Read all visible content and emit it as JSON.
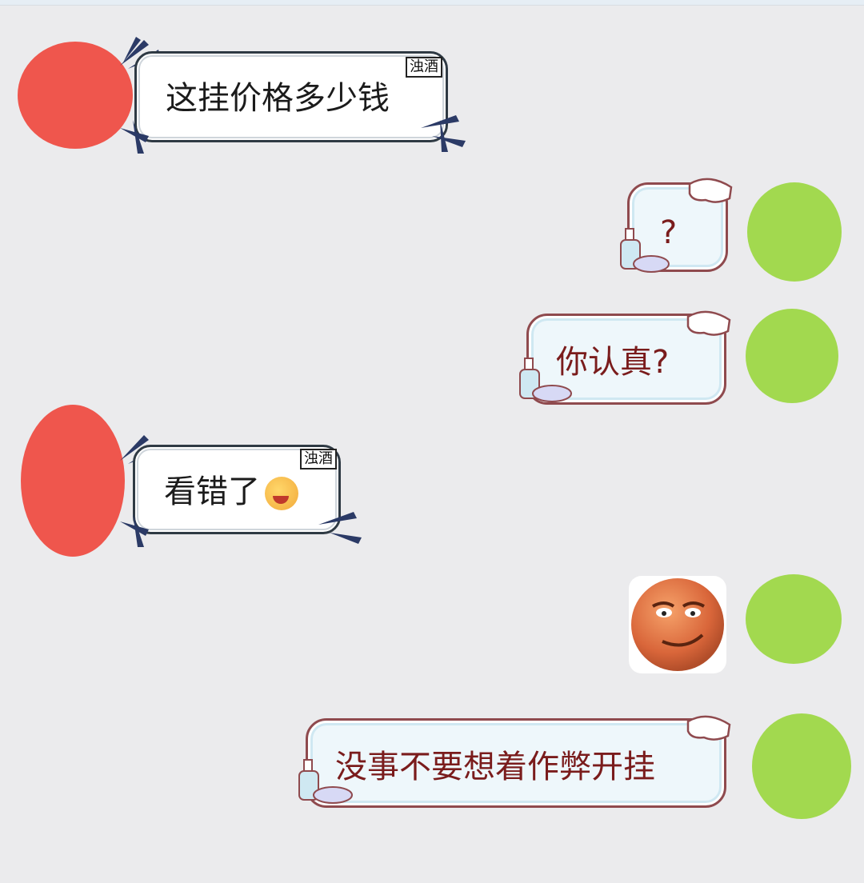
{
  "messages": [
    {
      "side": "left",
      "text": "这挂价格多少钱",
      "tag": "浊酒"
    },
    {
      "side": "right",
      "text": "?"
    },
    {
      "side": "right",
      "text": "你认真?"
    },
    {
      "side": "left",
      "text": "看错了",
      "tag": "浊酒",
      "emoji": "facepalm-laugh-emoji"
    },
    {
      "side": "right",
      "sticker": "smirking-orange-ball-sticker"
    },
    {
      "side": "right",
      "text": "没事不要想着作弊开挂"
    }
  ],
  "colors": {
    "background": "#ebebed",
    "incoming_text": "#1b1b1b",
    "outgoing_text": "#7a1c1c",
    "redaction_left": "#ef564d",
    "redaction_right": "#a2d94f"
  }
}
